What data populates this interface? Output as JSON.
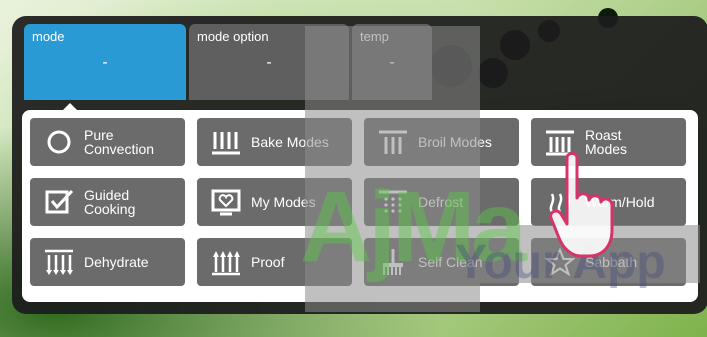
{
  "tabs": [
    {
      "label": "mode",
      "value": "-"
    },
    {
      "label": "mode option",
      "value": "-"
    },
    {
      "label": "temp",
      "value": "-"
    }
  ],
  "modes": [
    {
      "label": "Pure Convection",
      "icon": "circle-icon"
    },
    {
      "label": "Bake Modes",
      "icon": "bake-icon"
    },
    {
      "label": "Broil Modes",
      "icon": "broil-icon"
    },
    {
      "label": "Roast Modes",
      "icon": "roast-icon"
    },
    {
      "label": "Guided Cooking",
      "icon": "guided-cooking-icon"
    },
    {
      "label": "My Modes",
      "icon": "heart-screen-icon"
    },
    {
      "label": "Defrost",
      "icon": "defrost-icon"
    },
    {
      "label": "Warm/Hold",
      "icon": "warm-hold-icon"
    },
    {
      "label": "Dehydrate",
      "icon": "dehydrate-icon"
    },
    {
      "label": "Proof",
      "icon": "proof-icon"
    },
    {
      "label": "Self Clean",
      "icon": "broom-icon"
    },
    {
      "label": "Sabbath",
      "icon": "star-icon"
    }
  ],
  "watermark": {
    "main": "AjMa",
    "sub": "Your App"
  },
  "colors": {
    "active_tab": "#2a9ad4",
    "tab": "#5f5f5f",
    "button": "#6b6b6b",
    "panel": "#1c1c1c"
  }
}
